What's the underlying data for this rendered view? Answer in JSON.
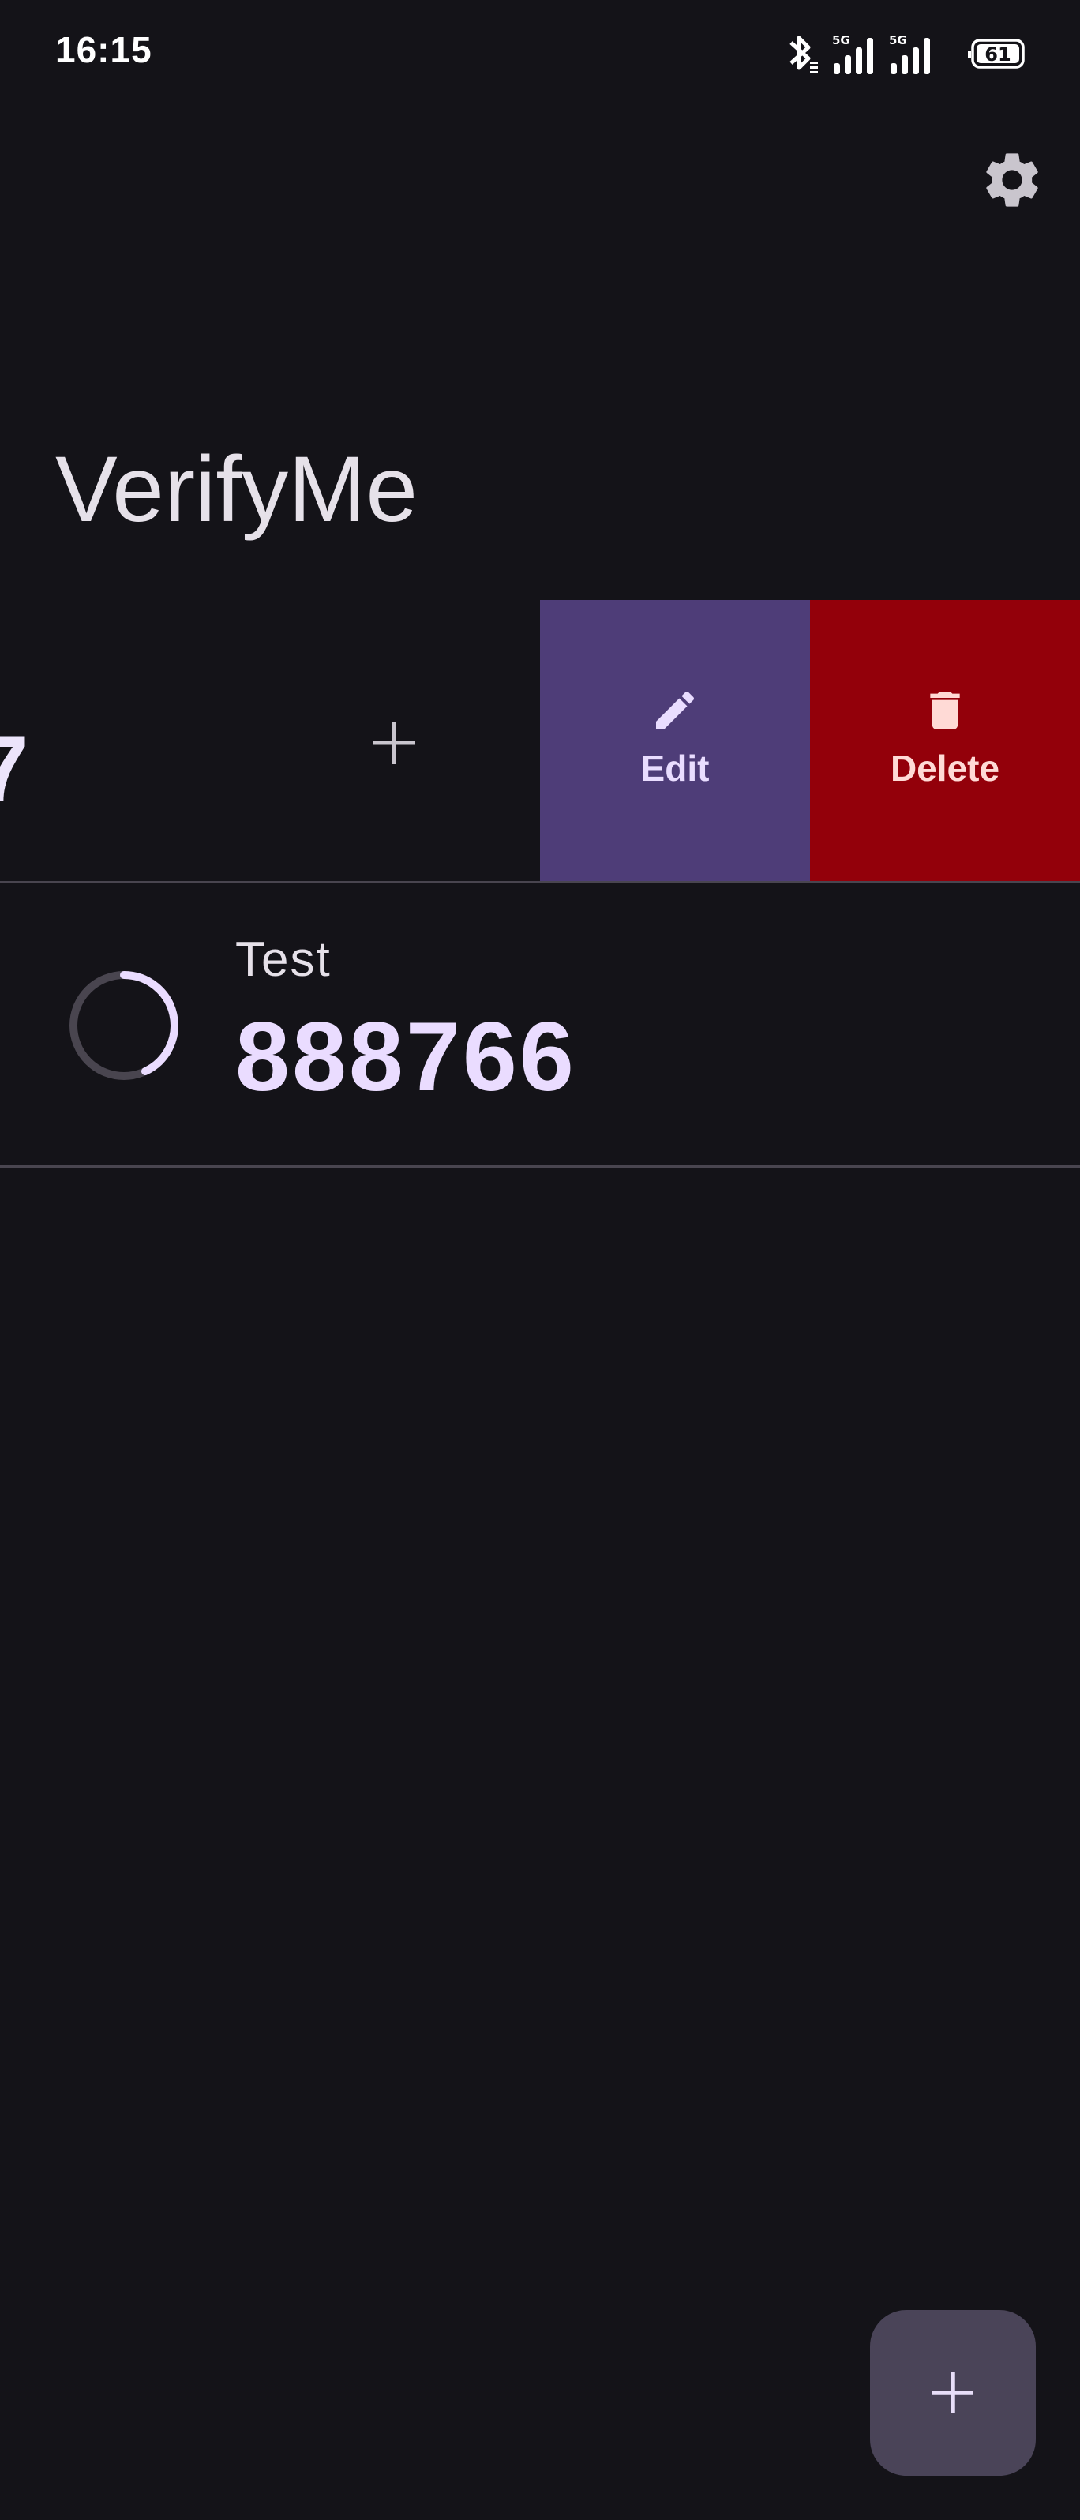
{
  "status_bar": {
    "time": "16:15",
    "battery_level": "61",
    "network_label": "5G",
    "icons": [
      "bluetooth-icon",
      "signal-5g-icon",
      "signal-5g-icon",
      "battery-icon"
    ]
  },
  "app_bar": {
    "title": "VerifyMe",
    "settings_icon": "gear-icon"
  },
  "accounts": [
    {
      "code_fragment": "7",
      "action_icon": "plus-icon",
      "revealed_actions": [
        {
          "label": "Edit",
          "icon": "pencil-icon",
          "color": "#4e3d78"
        },
        {
          "label": "Delete",
          "icon": "trash-icon",
          "color": "#93000a"
        }
      ]
    },
    {
      "name": "Test",
      "code": "888766",
      "timer_icon": "countdown-ring-icon",
      "time_remaining_fraction": 0.4
    }
  ],
  "fab": {
    "icon": "plus-icon"
  },
  "colors": {
    "background": "#141318",
    "accent": "#eadcff",
    "edit": "#4e3d78",
    "delete": "#93000a",
    "fab": "#4a4458"
  }
}
